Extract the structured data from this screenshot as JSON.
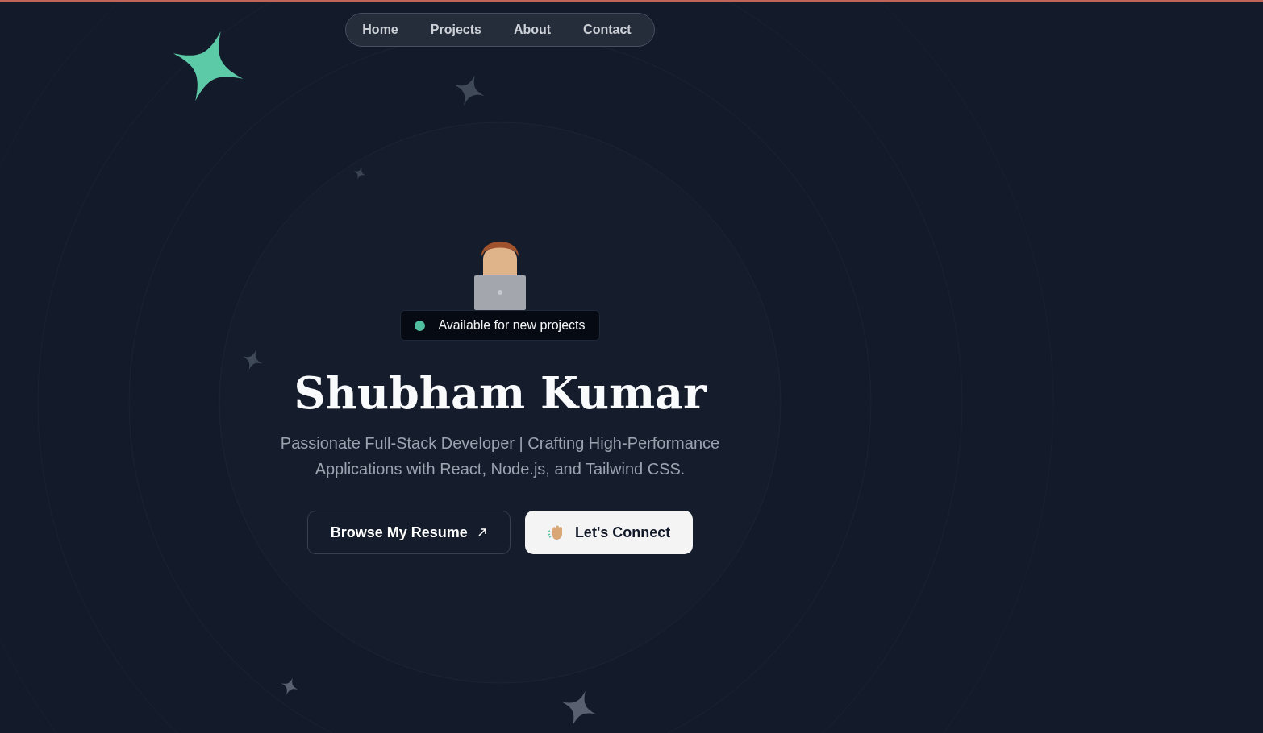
{
  "nav": {
    "items": [
      {
        "label": "Home"
      },
      {
        "label": "Projects"
      },
      {
        "label": "About"
      },
      {
        "label": "Contact"
      }
    ]
  },
  "hero": {
    "status": "Available for new projects",
    "name": "Shubham Kumar",
    "tagline": "Passionate Full-Stack Developer | Crafting High-Performance Applications with React, Node.js, and Tailwind CSS.",
    "buttons": [
      {
        "label": "Browse My Resume",
        "kind": "outline"
      },
      {
        "label": "Let's Connect",
        "kind": "solid"
      }
    ]
  }
}
